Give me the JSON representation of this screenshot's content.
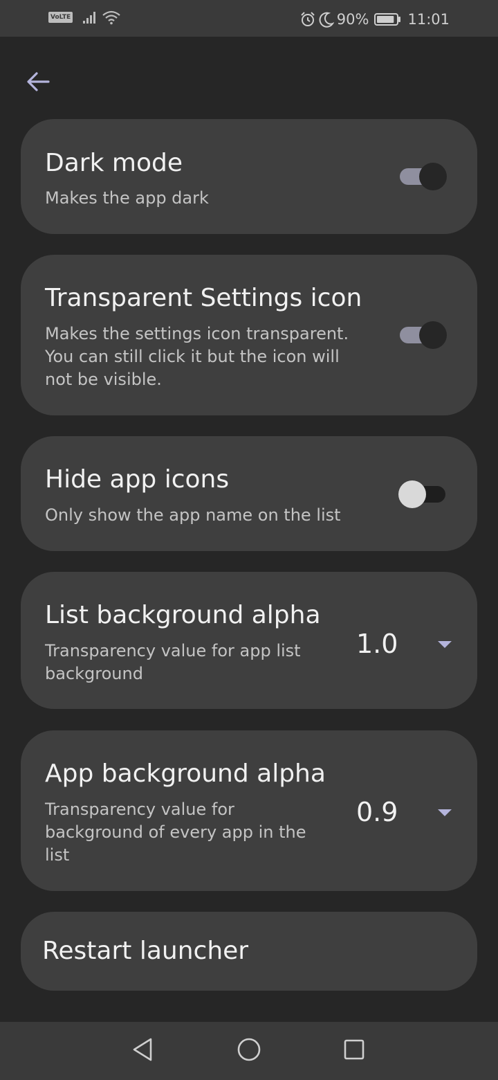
{
  "status_bar": {
    "volte": "VoLTE",
    "signal_icon": "signal-icon",
    "wifi_icon": "wifi-icon",
    "alarm_icon": "alarm-icon",
    "moon_icon": "moon-icon",
    "battery_percent": "90%",
    "battery_level": 0.9,
    "time": "11:01"
  },
  "header": {
    "back_icon": "arrow-back-icon"
  },
  "settings": {
    "dark_mode": {
      "title": "Dark mode",
      "subtitle": "Makes the app dark",
      "enabled": true
    },
    "transparent_icon": {
      "title": "Transparent Settings icon",
      "subtitle": "Makes the settings icon transparent. You can still click it but the icon will not be visible.",
      "enabled": true
    },
    "hide_icons": {
      "title": "Hide app icons",
      "subtitle": "Only show the app name on the list",
      "enabled": false
    },
    "list_alpha": {
      "title": "List background alpha",
      "subtitle": "Transparency value for app list background",
      "value": "1.0"
    },
    "app_alpha": {
      "title": "App background alpha",
      "subtitle": "Transparency value for background of every app in the list",
      "value": "0.9"
    },
    "restart": {
      "title": "Restart launcher"
    }
  },
  "nav_bar": {
    "back": "triangle-back-icon",
    "home": "circle-home-icon",
    "recents": "square-recents-icon"
  },
  "colors": {
    "background": "#262626",
    "card": "#3f3f3f",
    "accent": "#b4b4dc",
    "toggle_track_on": "#8f8f9f"
  }
}
